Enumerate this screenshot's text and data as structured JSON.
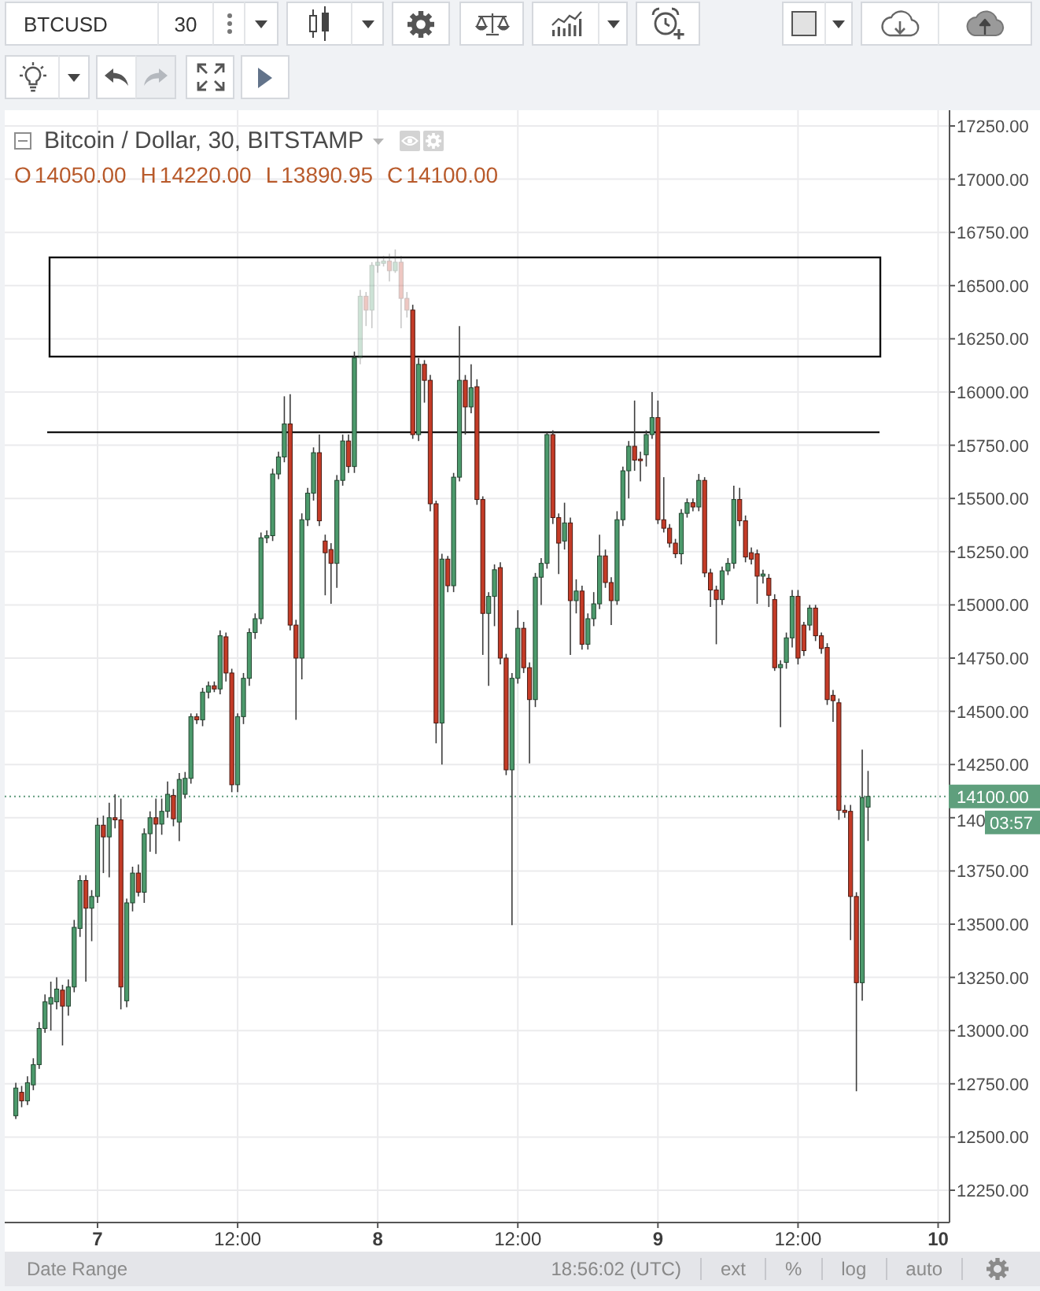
{
  "top_toolbar": {
    "symbol": "BTCUSD",
    "interval": "30"
  },
  "drawing_toolbar": {
    "history": [
      {
        "kind": "undo",
        "disabled": false
      },
      {
        "kind": "redo",
        "disabled": true
      }
    ]
  },
  "chart": {
    "legend": {
      "title": "Bitcoin / Dollar, 30, BITSTAMP",
      "ohlc": [
        {
          "label": "O",
          "value": "14050.00"
        },
        {
          "label": "H",
          "value": "14220.00"
        },
        {
          "label": "L",
          "value": "13890.95"
        },
        {
          "label": "C",
          "value": "14100.00"
        }
      ]
    },
    "chart_data": {
      "type": "candlestick",
      "grid": true,
      "categories": [
        null,
        null,
        null,
        null,
        null,
        null,
        null,
        null,
        null,
        null,
        null,
        null,
        null,
        null,
        "7",
        null,
        null,
        null,
        null,
        null,
        null,
        null,
        null,
        null,
        null,
        null,
        null,
        null,
        null,
        null,
        null,
        null,
        null,
        null,
        null,
        null,
        null,
        null,
        "12:00",
        null,
        null,
        null,
        null,
        null,
        null,
        null,
        null,
        null,
        null,
        null,
        null,
        null,
        null,
        null,
        null,
        null,
        null,
        null,
        null,
        null,
        null,
        null,
        "8",
        null,
        null,
        null,
        null,
        null,
        null,
        null,
        null,
        null,
        null,
        null,
        null,
        null,
        null,
        null,
        null,
        null,
        null,
        null,
        null,
        null,
        null,
        null,
        "12:00",
        null,
        null,
        null,
        null,
        null,
        null,
        null,
        null,
        null,
        null,
        null,
        null,
        null,
        null,
        null,
        null,
        null,
        null,
        null,
        null,
        null,
        null,
        null,
        "9",
        null,
        null,
        null,
        null,
        null,
        null,
        null,
        null,
        null,
        null,
        null,
        null,
        null,
        null,
        null,
        null,
        null,
        null,
        null,
        null,
        null,
        null,
        null,
        "12:00",
        null,
        null,
        null,
        null,
        null,
        null,
        null,
        null,
        null,
        null,
        null,
        null,
        null,
        null,
        null,
        null,
        null,
        null,
        null,
        null,
        null,
        null,
        null,
        "10"
      ],
      "ohlc": [
        [
          12600,
          12755,
          12585,
          12730
        ],
        [
          12710,
          12740,
          12640,
          12670
        ],
        [
          12670,
          12785,
          12650,
          12755
        ],
        [
          12745,
          12870,
          12720,
          12840
        ],
        [
          12840,
          13040,
          12820,
          13010
        ],
        [
          13010,
          13170,
          12990,
          13135
        ],
        [
          13125,
          13230,
          13000,
          13155
        ],
        [
          13135,
          13250,
          13100,
          13195
        ],
        [
          13190,
          13215,
          12930,
          13115
        ],
        [
          13115,
          13240,
          13070,
          13205
        ],
        [
          13205,
          13520,
          13180,
          13485
        ],
        [
          13480,
          13730,
          13440,
          13705
        ],
        [
          13705,
          13730,
          13230,
          13575
        ],
        [
          13575,
          13660,
          13420,
          13630
        ],
        [
          13630,
          14000,
          13600,
          13965
        ],
        [
          13965,
          14010,
          13740,
          13910
        ],
        [
          13910,
          14070,
          13720,
          14000
        ],
        [
          14000,
          14110,
          13950,
          13990
        ],
        [
          13990,
          14090,
          13100,
          13205
        ],
        [
          13140,
          13620,
          13110,
          13600
        ],
        [
          13600,
          13770,
          13560,
          13740
        ],
        [
          13740,
          13780,
          13630,
          13650
        ],
        [
          13650,
          13950,
          13600,
          13925
        ],
        [
          13925,
          14030,
          13840,
          14000
        ],
        [
          14000,
          14090,
          13830,
          13970
        ],
        [
          13970,
          14090,
          13920,
          14030
        ],
        [
          14030,
          14170,
          14000,
          14110
        ],
        [
          14105,
          14135,
          13960,
          13995
        ],
        [
          13980,
          14210,
          13890,
          14180
        ],
        [
          14110,
          14215,
          14090,
          14185
        ],
        [
          14185,
          14490,
          14160,
          14475
        ],
        [
          14475,
          14490,
          14440,
          14460
        ],
        [
          14460,
          14610,
          14430,
          14590
        ],
        [
          14590,
          14640,
          14560,
          14620
        ],
        [
          14620,
          14640,
          14590,
          14605
        ],
        [
          14605,
          14880,
          14580,
          14855
        ],
        [
          14850,
          14870,
          14640,
          14680
        ],
        [
          14680,
          14700,
          14120,
          14155
        ],
        [
          14155,
          14490,
          14120,
          14475
        ],
        [
          14475,
          14680,
          14440,
          14655
        ],
        [
          14655,
          14890,
          14620,
          14870
        ],
        [
          14870,
          14960,
          14840,
          14935
        ],
        [
          14935,
          15340,
          14910,
          15315
        ],
        [
          15315,
          15350,
          15290,
          15325
        ],
        [
          15325,
          15640,
          15300,
          15615
        ],
        [
          15615,
          15720,
          15590,
          15695
        ],
        [
          15695,
          15980,
          15670,
          15850
        ],
        [
          15850,
          15990,
          14880,
          14905
        ],
        [
          14905,
          14930,
          14460,
          14750
        ],
        [
          14750,
          15430,
          14650,
          15400
        ],
        [
          15400,
          15550,
          15370,
          15525
        ],
        [
          15525,
          15740,
          15490,
          15715
        ],
        [
          15715,
          15800,
          15370,
          15395
        ],
        [
          15300,
          15330,
          15045,
          15245
        ],
        [
          15260,
          15290,
          15005,
          15195
        ],
        [
          15195,
          15610,
          15080,
          15585
        ],
        [
          15585,
          15800,
          15560,
          15770
        ],
        [
          15770,
          15800,
          15620,
          15650
        ],
        [
          15650,
          16190,
          15620,
          16160
        ],
        [
          16160,
          16480,
          16130,
          16450
        ],
        [
          16450,
          16470,
          16310,
          16385
        ],
        [
          16385,
          16610,
          16300,
          16595
        ],
        [
          16595,
          16630,
          16560,
          16610
        ],
        [
          16605,
          16640,
          16590,
          16615
        ],
        [
          16615,
          16650,
          16520,
          16570
        ],
        [
          16570,
          16670,
          16560,
          16610
        ],
        [
          16610,
          16640,
          16300,
          16440
        ],
        [
          16440,
          16470,
          16350,
          16385
        ],
        [
          16385,
          16410,
          15780,
          15800
        ],
        [
          15800,
          16160,
          15770,
          16130
        ],
        [
          16130,
          16150,
          15950,
          16055
        ],
        [
          16055,
          16080,
          15440,
          15475
        ],
        [
          15475,
          15490,
          14350,
          14445
        ],
        [
          14445,
          15240,
          14250,
          15215
        ],
        [
          15215,
          15230,
          15060,
          15090
        ],
        [
          15090,
          15620,
          15060,
          15600
        ],
        [
          15600,
          16310,
          15580,
          16055
        ],
        [
          16055,
          16080,
          15800,
          15930
        ],
        [
          15930,
          16130,
          15900,
          16020
        ],
        [
          16025,
          16060,
          15470,
          15495
        ],
        [
          15495,
          15510,
          14765,
          14960
        ],
        [
          14960,
          15060,
          14620,
          15040
        ],
        [
          15040,
          15190,
          14900,
          15165
        ],
        [
          15175,
          15200,
          14720,
          14750
        ],
        [
          14750,
          14770,
          14200,
          14225
        ],
        [
          14225,
          14680,
          13495,
          14655
        ],
        [
          14655,
          14975,
          14630,
          14890
        ],
        [
          14890,
          14920,
          14680,
          14705
        ],
        [
          14705,
          14730,
          14255,
          14555
        ],
        [
          14555,
          15150,
          14520,
          15130
        ],
        [
          15130,
          15220,
          15000,
          15195
        ],
        [
          15195,
          15810,
          15170,
          15800
        ],
        [
          15800,
          15820,
          15380,
          15410
        ],
        [
          15410,
          15430,
          15145,
          15290
        ],
        [
          15300,
          15480,
          15260,
          15385
        ],
        [
          15385,
          15410,
          14765,
          15020
        ],
        [
          15020,
          15120,
          14960,
          15065
        ],
        [
          15065,
          15090,
          14790,
          14815
        ],
        [
          14815,
          14960,
          14790,
          14935
        ],
        [
          14935,
          15060,
          14900,
          15005
        ],
        [
          15005,
          15330,
          14980,
          15230
        ],
        [
          15230,
          15260,
          15080,
          15105
        ],
        [
          15105,
          15130,
          14905,
          15020
        ],
        [
          15020,
          15440,
          15000,
          15400
        ],
        [
          15400,
          15650,
          15370,
          15630
        ],
        [
          15630,
          15770,
          15500,
          15745
        ],
        [
          15745,
          15960,
          15630,
          15680
        ],
        [
          15685,
          15720,
          15580,
          15680
        ],
        [
          15705,
          15820,
          15650,
          15800
        ],
        [
          15800,
          16000,
          15780,
          15880
        ],
        [
          15880,
          15960,
          15380,
          15400
        ],
        [
          15400,
          15600,
          15340,
          15360
        ],
        [
          15360,
          15380,
          15270,
          15290
        ],
        [
          15290,
          15310,
          15220,
          15240
        ],
        [
          15240,
          15450,
          15190,
          15430
        ],
        [
          15430,
          15500,
          15410,
          15480
        ],
        [
          15480,
          15500,
          15440,
          15460
        ],
        [
          15460,
          15615,
          15440,
          15585
        ],
        [
          15585,
          15600,
          15130,
          15150
        ],
        [
          15150,
          15170,
          14990,
          15070
        ],
        [
          15070,
          15090,
          14815,
          15025
        ],
        [
          15025,
          15180,
          15000,
          15160
        ],
        [
          15160,
          15220,
          15140,
          15195
        ],
        [
          15195,
          15560,
          15170,
          15495
        ],
        [
          15495,
          15550,
          15370,
          15395
        ],
        [
          15395,
          15420,
          15200,
          15225
        ],
        [
          15245,
          15270,
          15190,
          15215
        ],
        [
          15240,
          15260,
          15005,
          15135
        ],
        [
          15135,
          15165,
          15100,
          15145
        ],
        [
          15125,
          15145,
          14990,
          15045
        ],
        [
          15025,
          15050,
          14690,
          14705
        ],
        [
          14705,
          14740,
          14425,
          14720
        ],
        [
          14730,
          14870,
          14700,
          14845
        ],
        [
          14845,
          15070,
          14800,
          15040
        ],
        [
          15040,
          15070,
          14720,
          14750
        ],
        [
          14905,
          14920,
          14760,
          14785
        ],
        [
          14905,
          15000,
          14880,
          14985
        ],
        [
          14985,
          15000,
          14830,
          14855
        ],
        [
          14855,
          14870,
          14770,
          14795
        ],
        [
          14800,
          14820,
          14530,
          14555
        ],
        [
          14575,
          14600,
          14450,
          14550
        ],
        [
          14540,
          14560,
          13990,
          14035
        ],
        [
          14035,
          14060,
          14000,
          14025
        ],
        [
          14030,
          14060,
          13425,
          13630
        ],
        [
          13630,
          13650,
          12715,
          13225
        ],
        [
          13225,
          14320,
          13140,
          14095
        ],
        [
          14050,
          14220,
          13890.95,
          14100
        ],
        null,
        null,
        null,
        null,
        null,
        null,
        null,
        null,
        null,
        null,
        null,
        null
      ],
      "ylim": [
        12102,
        17324
      ],
      "yticks": [
        {
          "value": 17250,
          "label": "17250.00"
        },
        {
          "value": 17000,
          "label": "17000.00"
        },
        {
          "value": 16750,
          "label": "16750.00"
        },
        {
          "value": 16500,
          "label": "16500.00"
        },
        {
          "value": 16250,
          "label": "16250.00"
        },
        {
          "value": 16000,
          "label": "16000.00"
        },
        {
          "value": 15750,
          "label": "15750.00"
        },
        {
          "value": 15500,
          "label": "15500.00"
        },
        {
          "value": 15250,
          "label": "15250.00"
        },
        {
          "value": 15000,
          "label": "15000.00"
        },
        {
          "value": 14750,
          "label": "14750.00"
        },
        {
          "value": 14500,
          "label": "14500.00"
        },
        {
          "value": 14250,
          "label": "14250.00"
        },
        {
          "value": 13750,
          "label": "13750.00"
        },
        {
          "value": 13500,
          "label": "13500.00"
        },
        {
          "value": 13250,
          "label": "13250.00"
        },
        {
          "value": 13000,
          "label": "13000.00"
        },
        {
          "value": 12750,
          "label": "12750.00"
        },
        {
          "value": 12500,
          "label": "12500.00"
        },
        {
          "value": 12250,
          "label": "12250.00"
        }
      ],
      "ref_lines": [
        {
          "axis": "y",
          "value": 15811
        },
        {
          "axis": "y",
          "value": 14100
        }
      ]
    },
    "time_axis": {
      "label_bold": [
        true,
        false,
        true,
        false,
        true,
        false,
        true
      ]
    },
    "price_axis": {
      "last_price": "14100.00",
      "partial_label": "140",
      "countdown": "03:57"
    }
  },
  "status_bar": {
    "date_range": "Date Range",
    "clock": "18:56:02 (UTC)",
    "toggles": [
      "ext",
      "%",
      "log",
      "auto"
    ]
  }
}
